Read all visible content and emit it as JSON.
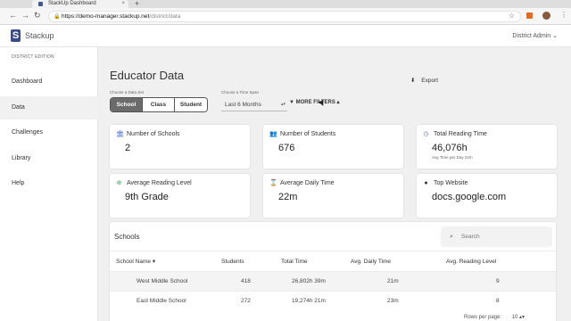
{
  "browser": {
    "tab_title": "StackUp Dashboard",
    "tab_close": "×",
    "new_tab": "+",
    "url_domain": "https://demo-manager.stackup.net",
    "url_path": "/district/data",
    "back": "←",
    "forward": "→",
    "reload": "↻",
    "lock": "🔒",
    "star": "☆",
    "menu": "⋮"
  },
  "header": {
    "logo_mark": "S",
    "logo_text": "Stackup",
    "user_menu": "District Admin ⌄"
  },
  "sidebar": {
    "edition": "DISTRICT EDITION",
    "items": [
      {
        "label": "Dashboard"
      },
      {
        "label": "Data",
        "active": true
      },
      {
        "label": "Challenges"
      },
      {
        "label": "Library"
      },
      {
        "label": "Help"
      }
    ]
  },
  "main": {
    "title": "Educator Data",
    "export_label": "Export",
    "export_icon": "⬇",
    "data_set_label": "Choose a Data Set",
    "data_sets": [
      "School",
      "Class",
      "Student"
    ],
    "time_span_label": "Choose a Time Span",
    "time_span_value": "Last 6 Months",
    "time_span_arrow": "▴▾",
    "more_filters": "▼ MORE FILTERS ▴",
    "cards": [
      {
        "label": "Number of Schools",
        "value": "2",
        "sub": "",
        "icon": "school-icon",
        "glyph": "🏛",
        "color": "#4a6fd1"
      },
      {
        "label": "Number of Students",
        "value": "676",
        "sub": "",
        "icon": "students-icon",
        "glyph": "👥",
        "color": "#4a90d9"
      },
      {
        "label": "Total Reading Time",
        "value": "46,076h",
        "sub": "Avg Time per Day 22m",
        "icon": "clock-icon",
        "glyph": "◷",
        "color": "#5a6fd1"
      },
      {
        "label": "Average Reading Level",
        "value": "9th Grade",
        "sub": "",
        "icon": "plus-circle-icon",
        "glyph": "⊕",
        "color": "#3aaa5a"
      },
      {
        "label": "Average Daily Time",
        "value": "22m",
        "sub": "",
        "icon": "hourglass-icon",
        "glyph": "⌛",
        "color": "#e2b23a"
      },
      {
        "label": "Top Website",
        "value": "docs.google.com",
        "sub": "",
        "icon": "globe-icon",
        "glyph": "●",
        "color": "#333333"
      }
    ],
    "schools": {
      "title": "Schools",
      "search_placeholder": "Search",
      "search_icon": "⌕",
      "columns": [
        "School Name ▾",
        "Students",
        "Total Time",
        "Avg. Daily Time",
        "Avg. Reading Level"
      ],
      "rows": [
        [
          "West Middle School",
          "418",
          "26,802h 39m",
          "21m",
          "9"
        ],
        [
          "East Middle School",
          "272",
          "19,274h 21m",
          "23m",
          "8"
        ]
      ],
      "rows_per_page_label": "Rows per page:",
      "rows_per_page_value": "10 ▴▾"
    }
  }
}
